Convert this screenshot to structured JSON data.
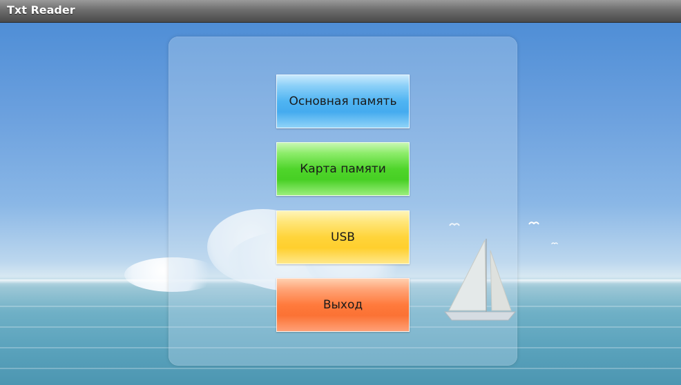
{
  "app": {
    "title": "Txt Reader"
  },
  "menu": {
    "buttons": [
      {
        "label": "Основная память",
        "color": "#4fb4f2"
      },
      {
        "label": "Карта памяти",
        "color": "#4fd52b"
      },
      {
        "label": "USB",
        "color": "#ffd43a"
      },
      {
        "label": "Выход",
        "color": "#ff7a3c"
      }
    ]
  },
  "background": {
    "scene": "sky-sea-sailboat"
  }
}
